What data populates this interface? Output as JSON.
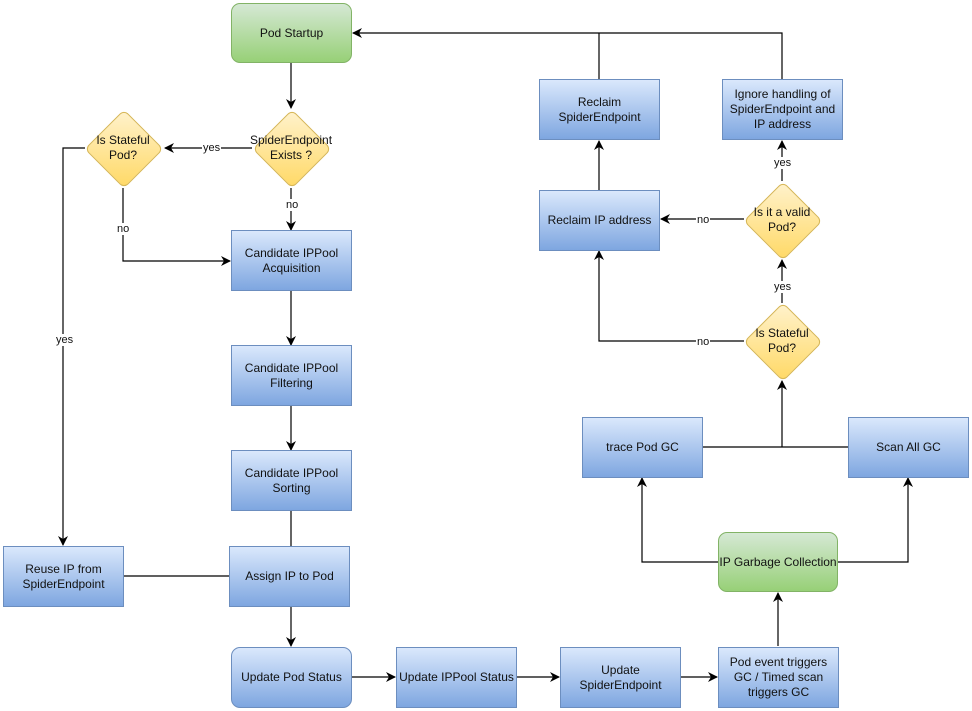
{
  "diagram": {
    "nodes": {
      "pod_startup": "Pod Startup",
      "spiderendpoint_exists": "SpiderEndpoint Exists ?",
      "is_stateful_left": "Is Stateful Pod?",
      "candidate_acquisition": "Candidate IPPool Acquisition",
      "candidate_filtering": "Candidate IPPool Filtering",
      "candidate_sorting": "Candidate IPPool Sorting",
      "reuse_ip": "Reuse IP from SpiderEndpoint",
      "assign_ip": "Assign IP to Pod",
      "update_pod_status": "Update Pod Status",
      "update_ippool_status": "Update IPPool Status",
      "update_spiderendpoint": "Update SpiderEndpoint",
      "pod_event_triggers": "Pod event triggers GC / Timed scan triggers GC",
      "ip_gc": "IP Garbage Collection",
      "trace_pod_gc": "trace Pod GC",
      "scan_all_gc": "Scan All GC",
      "is_stateful_right": "Is Stateful Pod?",
      "is_valid_pod": "Is it a valid Pod?",
      "reclaim_ip": "Reclaim IP address",
      "reclaim_spiderendpoint": "Reclaim SpiderEndpoint",
      "ignore_handling": "Ignore handling of SpiderEndpoint and IP address"
    },
    "edge_labels": {
      "exists_yes": "yes",
      "exists_no": "no",
      "stateful_left_no": "no",
      "stateful_left_yes": "yes",
      "stateful_right_yes": "yes",
      "stateful_right_no": "no",
      "valid_yes": "yes",
      "valid_no": "no"
    },
    "colors": {
      "process_fill": "#dae8fc",
      "process_stroke": "#6c8ebf",
      "terminal_fill": "#d5e8d4",
      "terminal_stroke": "#82b366",
      "decision_fill": "#fff2cc",
      "decision_stroke": "#d6b656",
      "edge": "#000000"
    }
  }
}
